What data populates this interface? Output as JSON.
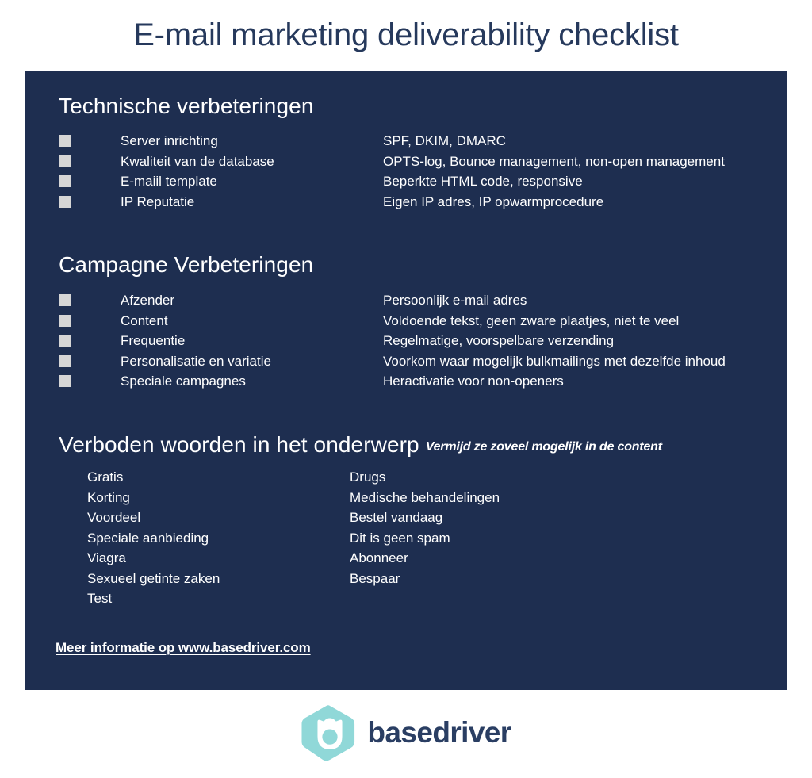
{
  "document": {
    "title": "E-mail marketing deliverability checklist"
  },
  "colors": {
    "panel_background": "#1e2e50",
    "title_text": "#26395c",
    "checkbox_fill": "#d6d6d6",
    "logo_teal": "#90d8d8",
    "logo_navy": "#2a3e63",
    "body_text": "#ffffff"
  },
  "sections": {
    "technical": {
      "heading": "Technische verbeteringen",
      "rows": [
        {
          "label": "Server inrichting",
          "detail": "SPF, DKIM, DMARC",
          "checked": false
        },
        {
          "label": "Kwaliteit van de database",
          "detail": "OPTS-log, Bounce management, non-open management",
          "checked": false
        },
        {
          "label": "E-maiil template",
          "detail": "Beperkte HTML code, responsive",
          "checked": false
        },
        {
          "label": "IP Reputatie",
          "detail": "Eigen IP adres, IP opwarmprocedure",
          "checked": false
        }
      ]
    },
    "campaign": {
      "heading": "Campagne Verbeteringen",
      "rows": [
        {
          "label": "Afzender",
          "detail": "Persoonlijk e-mail adres",
          "checked": false
        },
        {
          "label": "Content",
          "detail": "Voldoende tekst, geen zware plaatjes, niet te veel",
          "checked": false
        },
        {
          "label": "Frequentie",
          "detail": "Regelmatige, voorspelbare verzending",
          "checked": false
        },
        {
          "label": "Personalisatie en variatie",
          "detail": "Voorkom waar mogelijk bulkmailings met dezelfde inhoud",
          "checked": false
        },
        {
          "label": "Speciale campagnes",
          "detail": "Heractivatie voor non-openers",
          "checked": false
        }
      ]
    },
    "forbidden_words": {
      "heading": "Verboden woorden in het onderwerp",
      "subheading": "Vermijd ze zoveel mogelijk in de content",
      "column_left": [
        "Gratis",
        "Korting",
        "Voordeel",
        "Speciale aanbieding",
        "Viagra",
        "Sexueel getinte zaken",
        "Test"
      ],
      "column_right": [
        "Drugs",
        "Medische behandelingen",
        "Bestel vandaag",
        "Dit is geen spam",
        "Abonneer",
        "Bespaar"
      ]
    }
  },
  "footer": {
    "more_info_link": "Meer informatie op www.basedriver.com",
    "logo_wordmark": "basedriver",
    "logo_icon_name": "basedriver-hexagon-logo"
  }
}
